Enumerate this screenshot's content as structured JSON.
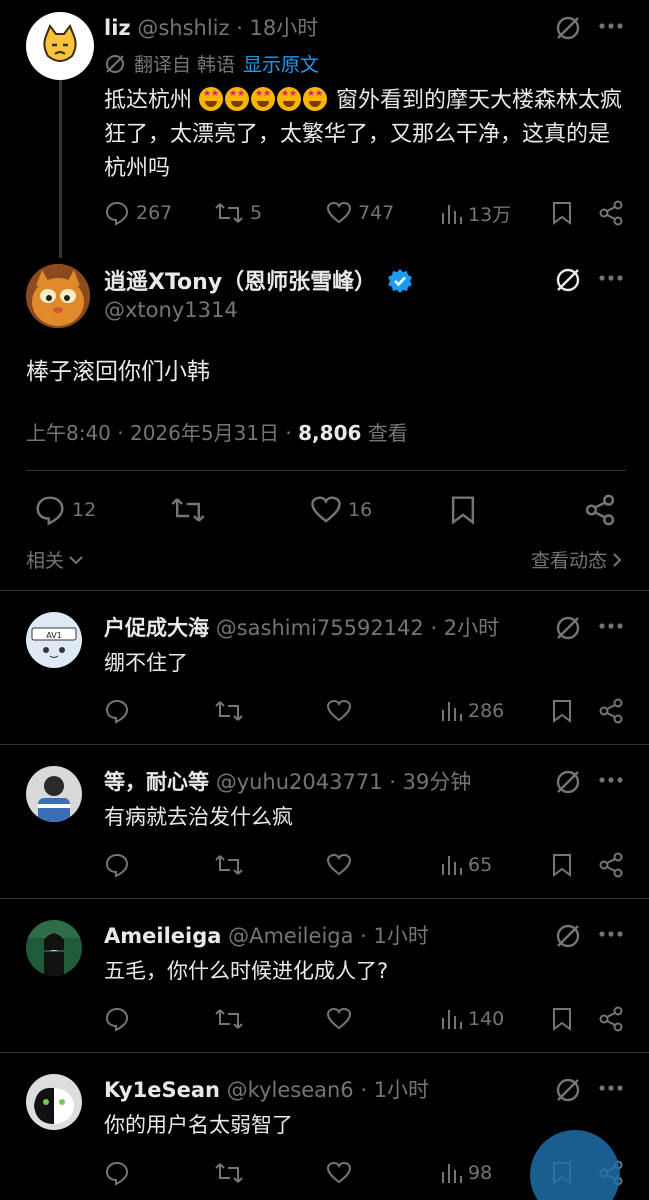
{
  "parent": {
    "name": "liz",
    "handle": "@shshliz",
    "time": "· 18小时",
    "translated_from": "翻译自 韩语",
    "show_original": "显示原文",
    "text_before": "抵达杭州",
    "text_after": " 窗外看到的摩天大楼森林太疯狂了，太漂亮了，太繁华了，又那么干净，这真的是杭州吗",
    "replies": "267",
    "retweets": "5",
    "likes": "747",
    "views": "13万"
  },
  "main": {
    "name": "逍遥XTony（恩师张雪峰）",
    "handle": "@xtony1314",
    "text": "棒子滚回你们小韩",
    "time": "上午8:40 · 2026年5月31日 · ",
    "views": "8,806",
    "views_label": " 查看",
    "replies": "12",
    "likes": "16",
    "related": "相关",
    "activity": "查看动态"
  },
  "replies": [
    {
      "name": "户促成大海",
      "handle": "@sashimi75592142",
      "time": "· 2小时",
      "text": "绷不住了",
      "views": "286"
    },
    {
      "name": "等，耐心等",
      "handle": "@yuhu2043771",
      "time": "· 39分钟",
      "text": "有病就去治发什么疯",
      "views": "65"
    },
    {
      "name": "Ameileiga",
      "handle": "@Ameileiga",
      "time": "· 1小时",
      "text": "五毛，你什么时候进化成人了?",
      "views": "140"
    },
    {
      "name": "Ky1eSean",
      "handle": "@kylesean6",
      "time": "· 1小时",
      "text": "你的用户名太弱智了",
      "views": "98"
    }
  ],
  "avatar1_text": "开你户口中",
  "colors": {
    "accent": "#1d9bf0",
    "bg": "#000000",
    "muted": "#71767b"
  }
}
